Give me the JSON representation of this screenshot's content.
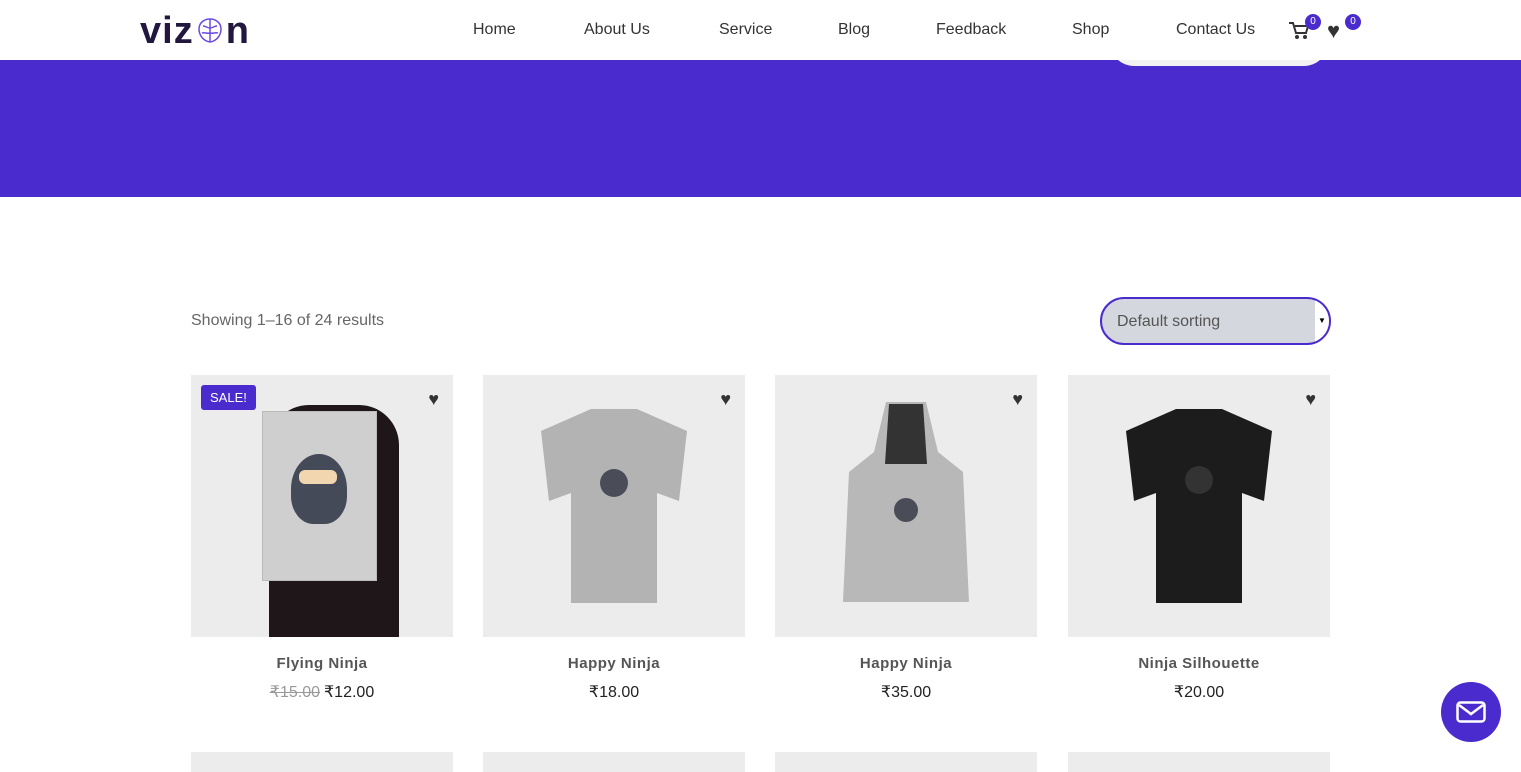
{
  "header": {
    "logo": "vizion",
    "nav": [
      "Home",
      "About Us",
      "Service",
      "Blog",
      "Feedback",
      "Shop",
      "Contact Us"
    ],
    "cart_count": "0",
    "wishlist_count": "0"
  },
  "shop": {
    "result_count": "Showing 1–16 of 24 results",
    "sorting": "Default sorting"
  },
  "products": [
    {
      "name": "Flying Ninja",
      "old_price": "₹15.00",
      "price": "₹12.00",
      "badge": "SALE!"
    },
    {
      "name": "Happy Ninja",
      "price": "₹18.00"
    },
    {
      "name": "Happy Ninja",
      "price": "₹35.00"
    },
    {
      "name": "Ninja Silhouette",
      "price": "₹20.00"
    }
  ],
  "colors": {
    "accent": "#4a2bcd",
    "dark": "#22173f"
  }
}
